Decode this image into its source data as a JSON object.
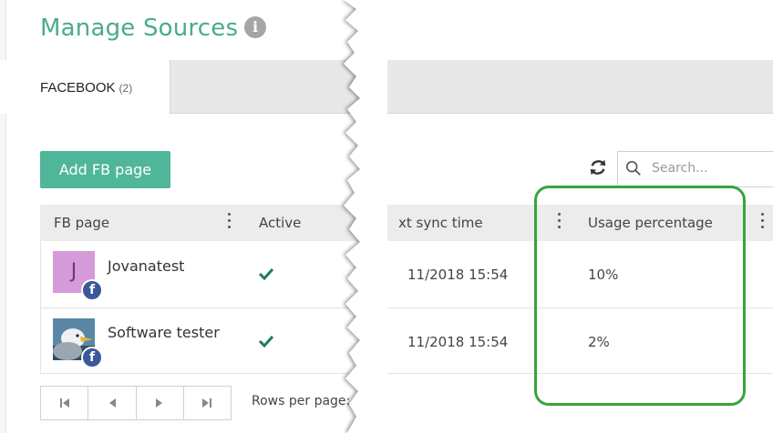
{
  "header": {
    "title": "Manage Sources",
    "info_icon": "info-icon"
  },
  "tabs": [
    {
      "label": "FACEBOOK",
      "count": "(2)",
      "active": true
    }
  ],
  "toolbar": {
    "add_button": "Add FB page",
    "refresh_icon": "refresh-icon",
    "search_placeholder": "Search..."
  },
  "table": {
    "columns": {
      "fb_page": "FB page",
      "active": "Active",
      "next_sync": "xt sync time",
      "usage": "Usage percentage"
    },
    "rows": [
      {
        "avatar_letter": "J",
        "name": "Jovanatest",
        "active": true,
        "next_sync": "11/2018 15:54",
        "usage": "10%"
      },
      {
        "avatar_letter": "",
        "name": "Software tester",
        "active": true,
        "next_sync": "11/2018 15:54",
        "usage": "2%"
      }
    ]
  },
  "pagination": {
    "rows_per_page_label": "Rows per page:"
  },
  "colors": {
    "accent": "#4fb699",
    "title": "#4aab8f",
    "highlight": "#3aa43a",
    "facebook": "#3b5998",
    "check": "#1e7e5a"
  }
}
